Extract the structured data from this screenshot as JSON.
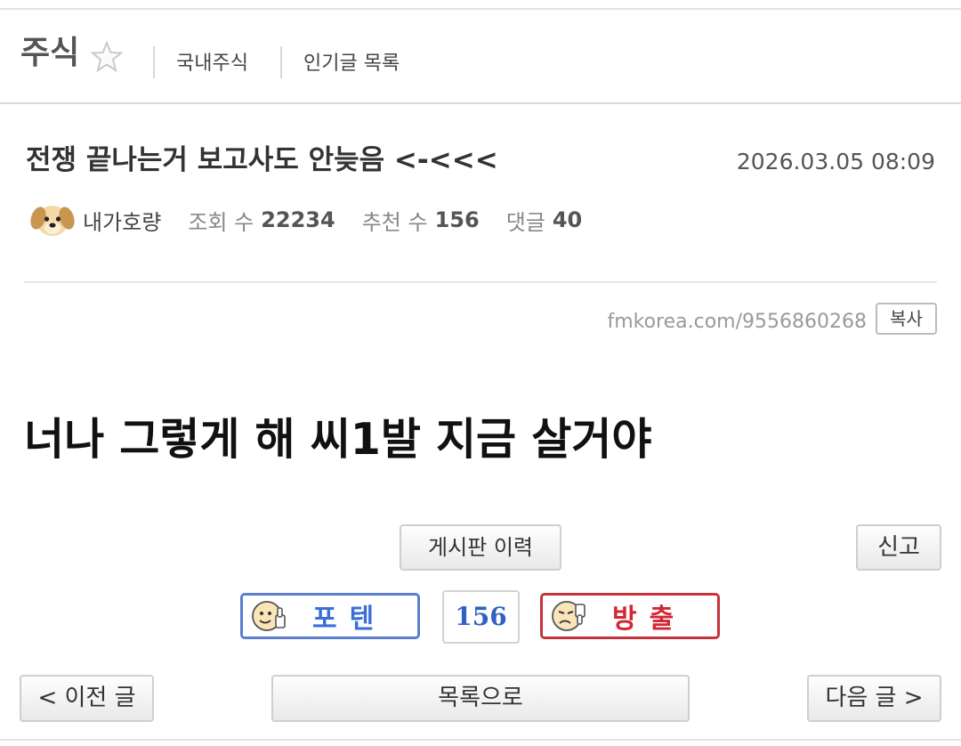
{
  "header": {
    "board_title": "주식",
    "nav": [
      "국내주식",
      "인기글 목록"
    ]
  },
  "post": {
    "title": "전쟁 끝나는거 보고사도 안늦음 <-<<<",
    "date": "2026.03.05 08:09",
    "author": "내가호량",
    "views_label": "조회 수",
    "views": "22234",
    "recommend_label": "추천 수",
    "recommend": "156",
    "comments_label": "댓글",
    "comments": "40",
    "url": "fmkorea.com/9556860268",
    "copy_label": "복사",
    "body": "너나 그렇게 해 씨1발 지금 살거야"
  },
  "actions": {
    "history_label": "게시판 이력",
    "report_label": "신고",
    "upvote_label": "포텐",
    "vote_count": "156",
    "downvote_label": "방출",
    "prev_label": "< 이전 글",
    "list_label": "목록으로",
    "next_label": "다음 글 >"
  },
  "icons": {
    "favorite": "star-outline-icon",
    "avatar": "puppy-avatar-icon",
    "upvote": "thumbs-up-face-icon",
    "downvote": "thumbs-down-face-icon"
  },
  "colors": {
    "upvote": "#3b6fd8",
    "downvote": "#d42634",
    "count": "#2f62c2"
  }
}
